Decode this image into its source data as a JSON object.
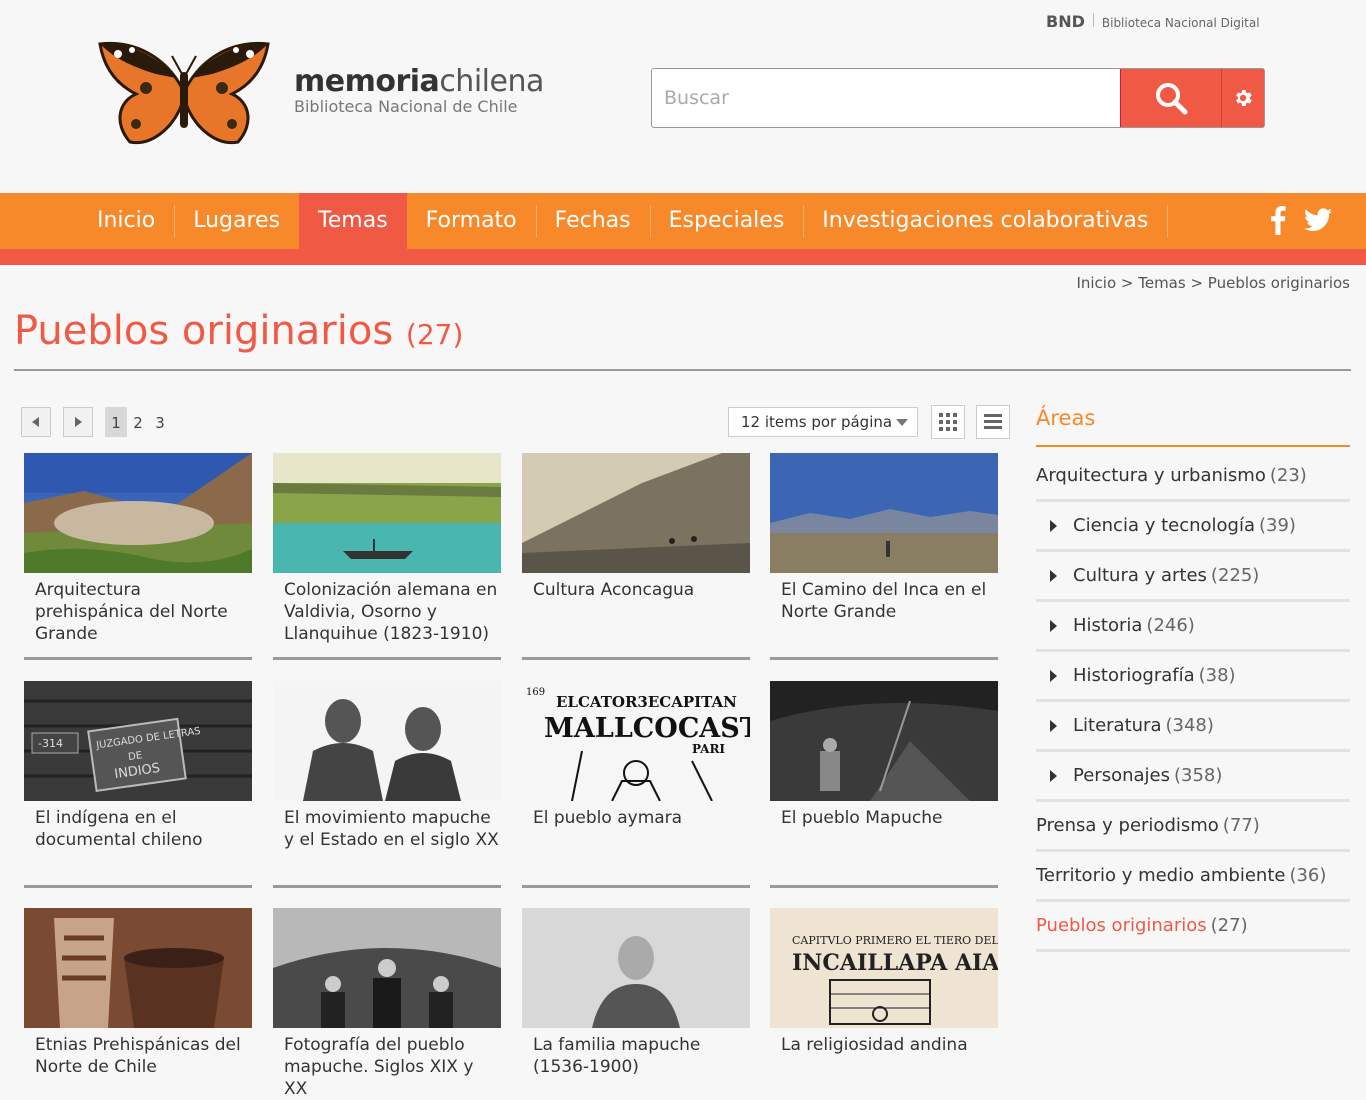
{
  "header": {
    "bnd_short": "BND",
    "bnd_name": "Biblioteca Nacional Digital",
    "brand_bold": "memoria",
    "brand_light": "chilena",
    "brand_sub": "Biblioteca Nacional de Chile",
    "search_placeholder": "Buscar"
  },
  "nav": {
    "items": [
      "Inicio",
      "Lugares",
      "Temas",
      "Formato",
      "Fechas",
      "Especiales",
      "Investigaciones colaborativas"
    ],
    "active": "Temas"
  },
  "breadcrumb": "Inicio > Temas > Pueblos originarios",
  "page": {
    "title": "Pueblos originarios",
    "count": "(27)"
  },
  "pager": {
    "pages": [
      "1",
      "2",
      "3"
    ],
    "current": "1"
  },
  "items_per_page": "12 items por página",
  "cards": [
    {
      "label": "Arquitectura prehispánica del Norte Grande"
    },
    {
      "label": "Colonización alemana en Valdivia, Osorno y Llanquihue (1823-1910)"
    },
    {
      "label": "Cultura Aconcagua"
    },
    {
      "label": "El Camino del Inca en el Norte Grande"
    },
    {
      "label": "El indígena en el documental chileno"
    },
    {
      "label": "El movimiento mapuche y el Estado en el siglo XX"
    },
    {
      "label": "El pueblo aymara"
    },
    {
      "label": "El pueblo Mapuche"
    },
    {
      "label": "Etnias Prehispánicas del Norte de Chile"
    },
    {
      "label": "Fotografía del pueblo mapuche. Siglos XIX y XX"
    },
    {
      "label": "La familia mapuche (1536-1900)"
    },
    {
      "label": "La religiosidad andina"
    }
  ],
  "thumb_text": {
    "sign_num": "-314",
    "sign_l1": "JUZGADO DE LETRAS",
    "sign_l2": "DE",
    "sign_l3": "INDIOS",
    "aymara_corner": "169",
    "aymara_l1": "ELCATOR3ECAPITAN",
    "aymara_l2": "MALLCOCASTILLA",
    "aymara_l3": "PARI",
    "relig_l1": "CAPITVLO PRIMERO EL TIERO DELIGA",
    "relig_l2": "INCAILLAPA AIADE FVIO"
  },
  "sidebar": {
    "title": "Áreas",
    "items": [
      {
        "label": "Arquitectura y urbanismo",
        "count": "(23)",
        "caret": false
      },
      {
        "label": "Ciencia y tecnología",
        "count": "(39)",
        "caret": true
      },
      {
        "label": "Cultura y artes",
        "count": "(225)",
        "caret": true
      },
      {
        "label": "Historia",
        "count": "(246)",
        "caret": true
      },
      {
        "label": "Historiografía",
        "count": "(38)",
        "caret": true
      },
      {
        "label": "Literatura",
        "count": "(348)",
        "caret": true
      },
      {
        "label": "Personajes",
        "count": "(358)",
        "caret": true
      },
      {
        "label": "Prensa y periodismo",
        "count": "(77)",
        "caret": false
      },
      {
        "label": "Territorio y medio ambiente",
        "count": "(36)",
        "caret": false
      },
      {
        "label": "Pueblos originarios",
        "count": "(27)",
        "caret": false,
        "active": true
      }
    ]
  },
  "colors": {
    "orange": "#f7892a",
    "red": "#f05a45"
  }
}
